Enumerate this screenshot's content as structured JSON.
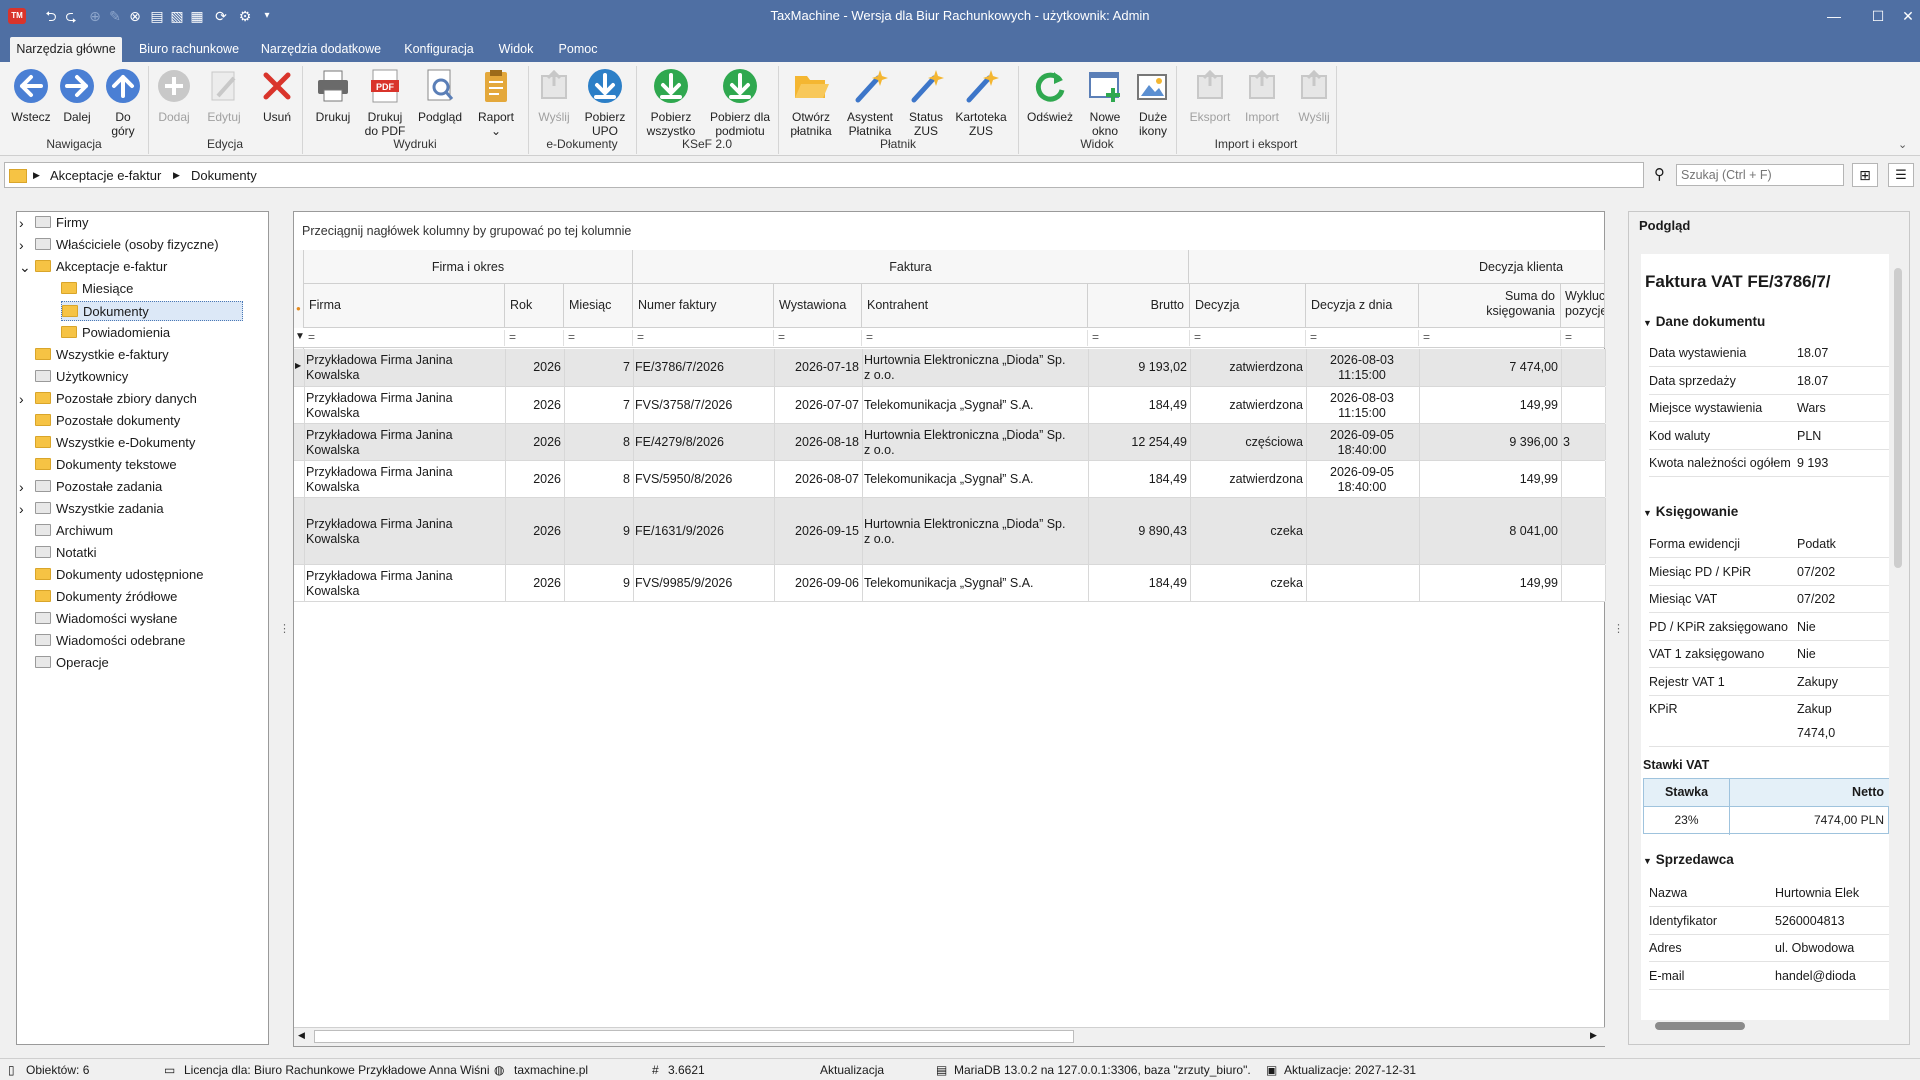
{
  "titlebar": {
    "title": "TaxMachine  -  Wersja dla Biur Rachunkowych  -  użytkownik: Admin",
    "logo": "TM"
  },
  "tabs": [
    "Narzędzia główne",
    "Biuro rachunkowe",
    "Narzędzia dodatkowe",
    "Konfiguracja",
    "Widok",
    "Pomoc"
  ],
  "ribbon": {
    "buttons": [
      {
        "l1": "Wstecz",
        "l2": "",
        "icon": "back-arrow-icon"
      },
      {
        "l1": "Dalej",
        "l2": "",
        "icon": "forward-arrow-icon"
      },
      {
        "l1": "Do",
        "l2": "góry",
        "icon": "up-arrow-icon"
      },
      {
        "l1": "Dodaj",
        "l2": "",
        "icon": "add-icon"
      },
      {
        "l1": "Edytuj",
        "l2": "",
        "icon": "edit-icon"
      },
      {
        "l1": "Usuń",
        "l2": "",
        "icon": "delete-icon"
      },
      {
        "l1": "Drukuj",
        "l2": "",
        "icon": "printer-icon"
      },
      {
        "l1": "Drukuj",
        "l2": "do PDF",
        "icon": "pdf-icon"
      },
      {
        "l1": "Podgląd",
        "l2": "",
        "icon": "preview-icon"
      },
      {
        "l1": "Raport",
        "l2": "⌄",
        "icon": "report-icon"
      },
      {
        "l1": "Wyślij",
        "l2": "",
        "icon": "send-icon"
      },
      {
        "l1": "Pobierz",
        "l2": "UPO",
        "icon": "download-upo-icon"
      },
      {
        "l1": "Pobierz",
        "l2": "wszystko",
        "icon": "download-all-icon"
      },
      {
        "l1": "Pobierz dla",
        "l2": "podmiotu",
        "icon": "download-entity-icon"
      },
      {
        "l1": "Otwórz",
        "l2": "płatnika",
        "icon": "open-folder-icon"
      },
      {
        "l1": "Asystent",
        "l2": "Płatnika",
        "icon": "wand-icon"
      },
      {
        "l1": "Status",
        "l2": "ZUS",
        "icon": "wand-icon"
      },
      {
        "l1": "Kartoteka",
        "l2": "ZUS",
        "icon": "wand-icon"
      },
      {
        "l1": "Odśwież",
        "l2": "",
        "icon": "refresh-icon"
      },
      {
        "l1": "Nowe",
        "l2": "okno",
        "icon": "new-window-icon"
      },
      {
        "l1": "Duże",
        "l2": "ikony",
        "icon": "large-icons-icon"
      },
      {
        "l1": "Eksport",
        "l2": "",
        "icon": "export-icon"
      },
      {
        "l1": "Import",
        "l2": "",
        "icon": "import-icon"
      },
      {
        "l1": "Wyślij",
        "l2": "",
        "icon": "send-mail-icon"
      }
    ],
    "groups": [
      "Nawigacja",
      "Edycja",
      "Wydruki",
      "e-Dokumenty",
      "KSeF 2.0",
      "Płatnik",
      "Widok",
      "Import i eksport"
    ]
  },
  "breadcrumb": {
    "part1": "Akceptacje e-faktur",
    "part2": "Dokumenty"
  },
  "search": {
    "placeholder": "Szukaj (Ctrl + F)"
  },
  "tree": [
    "Firmy",
    "Właściciele (osoby fizyczne)",
    "Akceptacje e-faktur",
    "Miesiące",
    "Dokumenty",
    "Powiadomienia",
    "Wszystkie e-faktury",
    "Użytkownicy",
    "Pozostałe zbiory danych",
    "Pozostałe dokumenty",
    "Wszystkie e-Dokumenty",
    "Dokumenty tekstowe",
    "Pozostałe zadania",
    "Wszystkie zadania",
    "Archiwum",
    "Notatki",
    "Dokumenty udostępnione",
    "Dokumenty źródłowe",
    "Wiadomości wysłane",
    "Wiadomości odebrane",
    "Operacje"
  ],
  "grid": {
    "hint": "Przeciągnij nagłówek kolumny by grupować po tej kolumnie",
    "bands": [
      "Firma i okres",
      "Faktura",
      "Decyzja klienta"
    ],
    "cols": [
      "Firma",
      "Rok",
      "Miesiąc",
      "Numer faktury",
      "Wystawiona",
      "Kontrahent",
      "Brutto",
      "Decyzja",
      "Decyzja z dnia",
      "Suma do",
      "księgowania",
      "Wykluczo",
      "pozycje"
    ],
    "filter": "=",
    "rows": [
      {
        "f1": "Przykładowa Firma Janina",
        "f2": "Kowalska",
        "rok": "2026",
        "m": "7",
        "nr": "FE/3786/7/2026",
        "wyst": "2026-07-18",
        "k1": "Hurtownia Elektroniczna „Dioda” Sp.",
        "k2": "z o.o.",
        "brutto": "9 193,02",
        "dec": "zatwierdzona",
        "d1": "2026-08-03",
        "d2": "11:15:00",
        "suma": "7 474,00",
        "wyk": ""
      },
      {
        "f1": "Przykładowa Firma Janina",
        "f2": "Kowalska",
        "rok": "2026",
        "m": "7",
        "nr": "FVS/3758/7/2026",
        "wyst": "2026-07-07",
        "k1": "Telekomunikacja „Sygnał” S.A.",
        "k2": "",
        "brutto": "184,49",
        "dec": "zatwierdzona",
        "d1": "2026-08-03",
        "d2": "11:15:00",
        "suma": "149,99",
        "wyk": ""
      },
      {
        "f1": "Przykładowa Firma Janina",
        "f2": "Kowalska",
        "rok": "2026",
        "m": "8",
        "nr": "FE/4279/8/2026",
        "wyst": "2026-08-18",
        "k1": "Hurtownia Elektroniczna „Dioda” Sp.",
        "k2": "z o.o.",
        "brutto": "12 254,49",
        "dec": "częściowa",
        "d1": "2026-09-05",
        "d2": "18:40:00",
        "suma": "9 396,00",
        "wyk": "3"
      },
      {
        "f1": "Przykładowa Firma Janina",
        "f2": "Kowalska",
        "rok": "2026",
        "m": "8",
        "nr": "FVS/5950/8/2026",
        "wyst": "2026-08-07",
        "k1": "Telekomunikacja „Sygnał” S.A.",
        "k2": "",
        "brutto": "184,49",
        "dec": "zatwierdzona",
        "d1": "2026-09-05",
        "d2": "18:40:00",
        "suma": "149,99",
        "wyk": ""
      },
      {
        "f1": "Przykładowa Firma Janina",
        "f2": "Kowalska",
        "rok": "2026",
        "m": "9",
        "nr": "FE/1631/9/2026",
        "wyst": "2026-09-15",
        "k1": "Hurtownia Elektroniczna „Dioda” Sp.",
        "k2": "z o.o.",
        "brutto": "9 890,43",
        "dec": "czeka",
        "d1": "",
        "d2": "",
        "suma": "8 041,00",
        "wyk": ""
      },
      {
        "f1": "Przykładowa Firma Janina",
        "f2": "Kowalska",
        "rok": "2026",
        "m": "9",
        "nr": "FVS/9985/9/2026",
        "wyst": "2026-09-06",
        "k1": "Telekomunikacja „Sygnał” S.A.",
        "k2": "",
        "brutto": "184,49",
        "dec": "czeka",
        "d1": "",
        "d2": "",
        "suma": "149,99",
        "wyk": ""
      }
    ]
  },
  "preview": {
    "header": "Podgląd",
    "doc_title": "Faktura VAT FE/3786/7/",
    "sec1": "Dane dokumentu",
    "sec1_rows": [
      [
        "Data wystawienia",
        "18.07"
      ],
      [
        "Data sprzedaży",
        "18.07"
      ],
      [
        "Miejsce wystawienia",
        "Wars"
      ],
      [
        "Kod waluty",
        "PLN"
      ],
      [
        "Kwota należności ogółem",
        "9 193"
      ]
    ],
    "sec2": "Księgowanie",
    "sec2_rows": [
      [
        "Forma ewidencji",
        "Podatk"
      ],
      [
        "Miesiąc PD / KPiR",
        "07/202"
      ],
      [
        "Miesiąc VAT",
        "07/202"
      ],
      [
        "PD / KPiR zaksięgowano",
        "Nie"
      ],
      [
        "VAT 1 zaksięgowano",
        "Nie"
      ],
      [
        "Rejestr VAT 1",
        "Zakupy"
      ],
      [
        "KPiR",
        "Zakup"
      ]
    ],
    "kpir_extra": "7474,0",
    "vat_title": "Stawki VAT",
    "vat_h1": "Stawka",
    "vat_h2": "Netto",
    "vat_v1": "23%",
    "vat_v2": "7474,00 PLN",
    "sec3": "Sprzedawca",
    "sec3_rows": [
      [
        "Nazwa",
        "Hurtownia Elek"
      ],
      [
        "Identyfikator",
        "5260004813"
      ],
      [
        "Adres",
        "ul. Obwodowa"
      ],
      [
        "E-mail",
        "handel@dioda"
      ]
    ]
  },
  "status": {
    "objects": "Obiektów: 6",
    "license": "Licencja dla: Biuro Rachunkowe Przykładowe Anna Wiśni",
    "site": "taxmachine.pl",
    "version": "3.6621",
    "update": "Aktualizacja",
    "db": "MariaDB 13.0.2 na 127.0.0.1:3306, baza \"zrzuty_biuro\".",
    "upd_date": "Aktualizacje: 2027-12-31"
  }
}
